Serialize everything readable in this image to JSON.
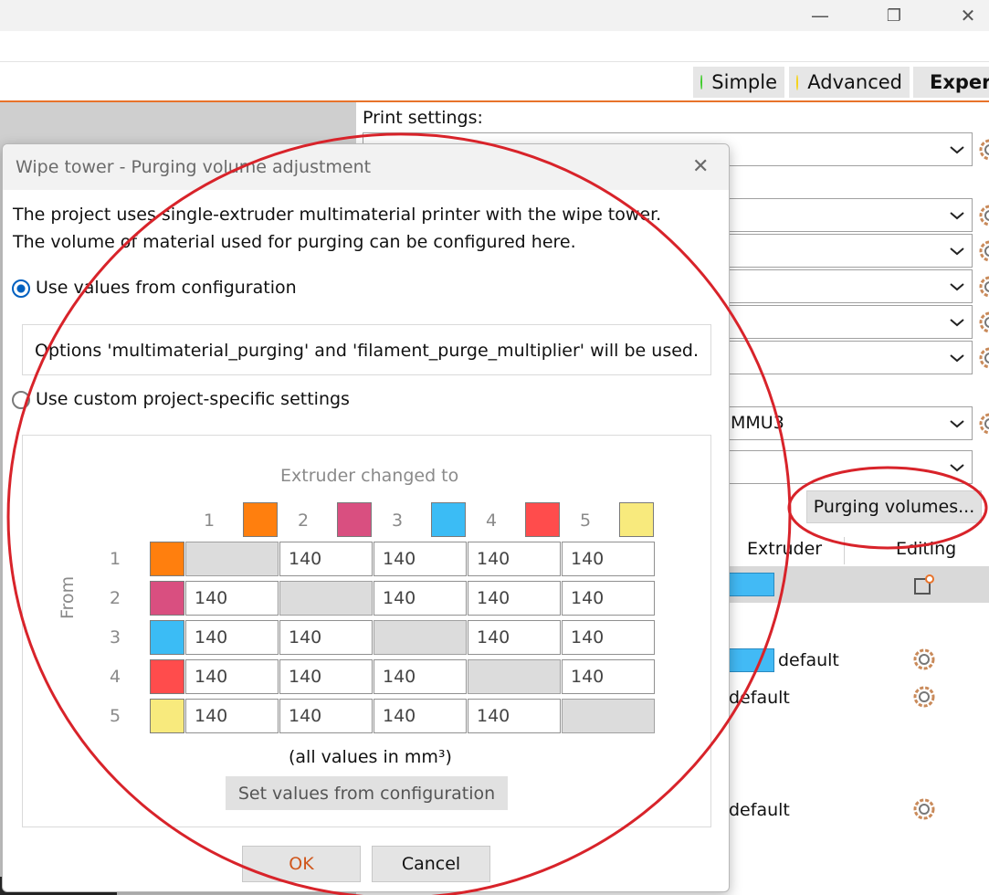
{
  "window": {
    "minimize_glyph": "—",
    "restore_glyph": "❐",
    "close_glyph": "✕"
  },
  "modes": [
    {
      "label": "Simple",
      "color": "#3fcc2b"
    },
    {
      "label": "Advanced",
      "color": "#f5d31a"
    },
    {
      "label": "Exper",
      "color": "#e0141b"
    }
  ],
  "print_settings": {
    "label": "Print settings:",
    "printer_value": "MMU3"
  },
  "purging_button": "Purging volumes...",
  "table_headers": {
    "extruder": "Extruder",
    "editing": "Editing"
  },
  "object_rows": [
    {
      "text": "default"
    },
    {
      "text": "default"
    },
    {
      "text": "default"
    }
  ],
  "dialog": {
    "title": "Wipe tower - Purging volume adjustment",
    "close_glyph": "✕",
    "intro_line1": "The project uses single-extruder multimaterial printer with the wipe tower.",
    "intro_line2": "The volume of material used for purging can be configured here.",
    "radio_config": "Use values from configuration",
    "options_text": "Options 'multimaterial_purging' and 'filament_purge_multiplier' will be used.",
    "radio_custom": "Use custom project-specific settings",
    "extruder_changed_to": "Extruder changed to",
    "from_label": "From",
    "units": "(all values in mm³)",
    "set_values_button": "Set values from configuration",
    "ok": "OK",
    "cancel": "Cancel",
    "extruders": [
      {
        "num": "1",
        "color": "#ff7f0e"
      },
      {
        "num": "2",
        "color": "#d94f80"
      },
      {
        "num": "3",
        "color": "#3bbcf5"
      },
      {
        "num": "4",
        "color": "#ff4c4c"
      },
      {
        "num": "5",
        "color": "#f8ea7d"
      }
    ],
    "matrix": [
      [
        "",
        "140",
        "140",
        "140",
        "140"
      ],
      [
        "140",
        "",
        "140",
        "140",
        "140"
      ],
      [
        "140",
        "140",
        "",
        "140",
        "140"
      ],
      [
        "140",
        "140",
        "140",
        "",
        "140"
      ],
      [
        "140",
        "140",
        "140",
        "140",
        ""
      ]
    ]
  },
  "annotation_color": "#d8232a"
}
